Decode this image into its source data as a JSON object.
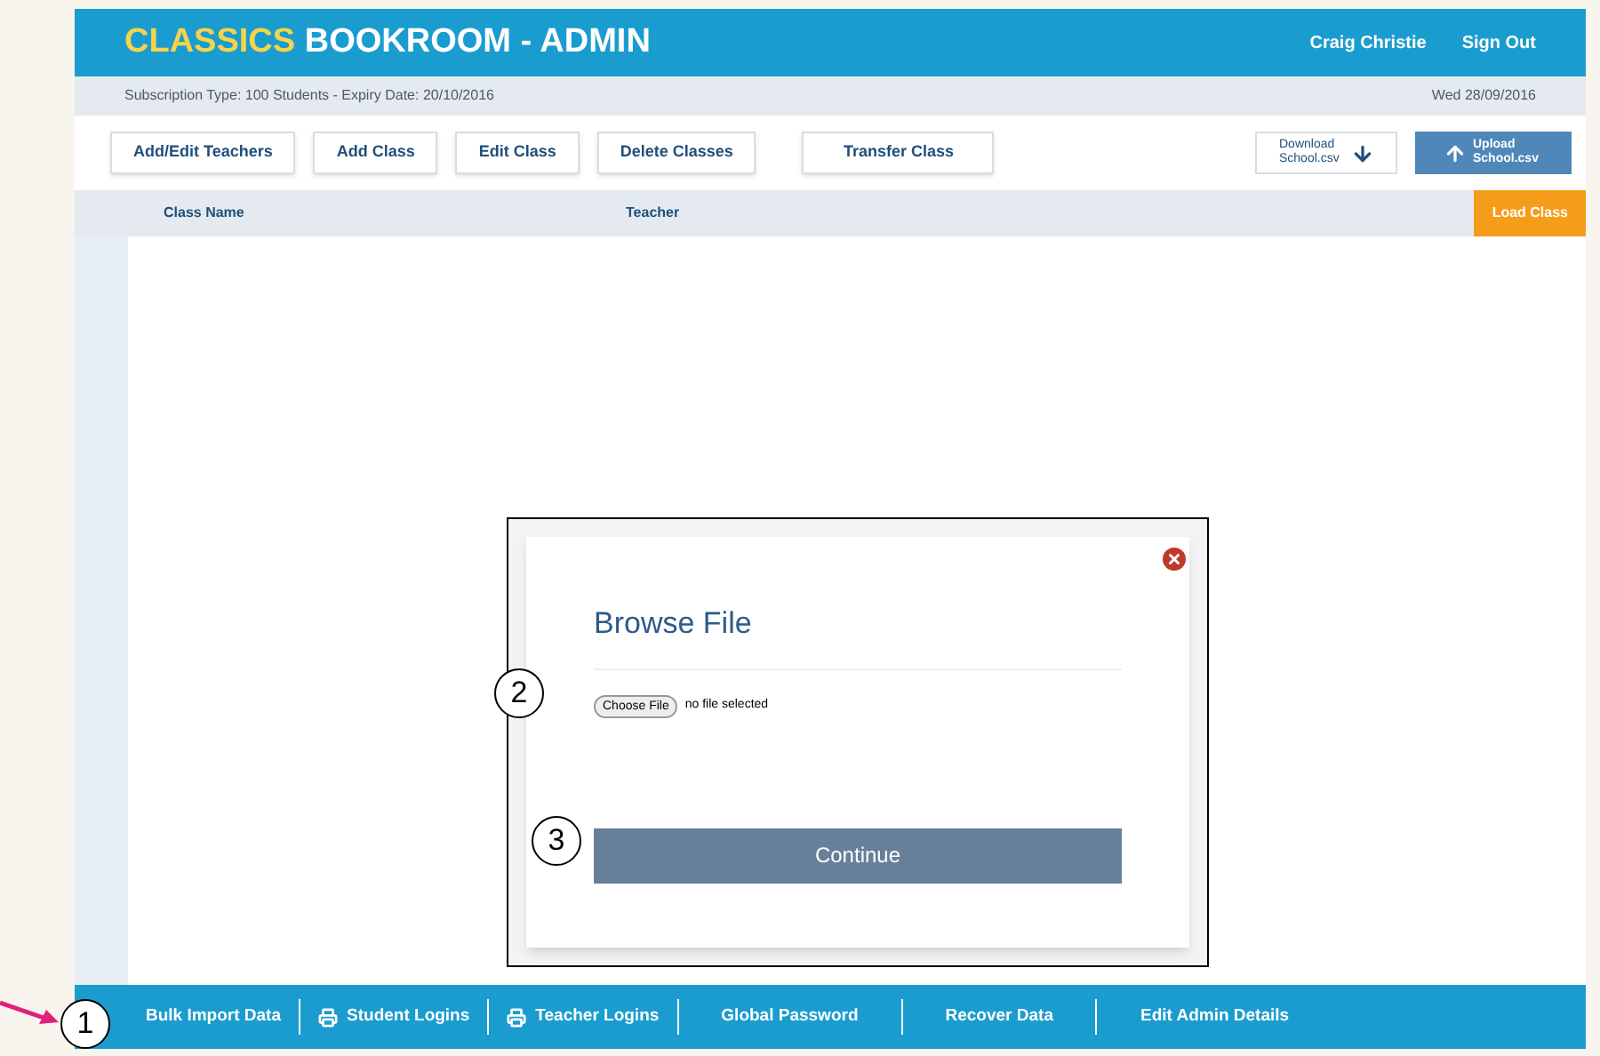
{
  "header": {
    "title_accent": "CLASSICS",
    "title": "BOOKROOM - ADMIN",
    "user": "Craig Christie",
    "sign_out": "Sign Out"
  },
  "subscription": {
    "text": "Subscription Type: 100 Students - Expiry Date: 20/10/2016",
    "date": "Wed 28/09/2016"
  },
  "toolbar": [
    "Add/Edit Teachers",
    "Add Class",
    "Edit Class",
    "Delete Classes",
    "Transfer Class"
  ],
  "download": {
    "label": "Download School.csv"
  },
  "upload": {
    "label": "Upload School.csv"
  },
  "table": {
    "columns": [
      "Class Name",
      "Teacher"
    ],
    "load_button": "Load Class"
  },
  "dialog": {
    "title": "Browse File",
    "choose_button": "Choose File",
    "file_status": "no file selected",
    "continue_button": "Continue"
  },
  "footer": [
    {
      "label": "Bulk Import Data",
      "kind": "plain"
    },
    {
      "label": "Student Logins",
      "kind": "print"
    },
    {
      "label": "Teacher Logins",
      "kind": "print"
    },
    {
      "label": "Global Password",
      "kind": "plain"
    },
    {
      "label": "Recover Data",
      "kind": "plain"
    },
    {
      "label": "Edit Admin Details",
      "kind": "plain"
    }
  ],
  "callouts": [
    "1",
    "2",
    "3"
  ]
}
